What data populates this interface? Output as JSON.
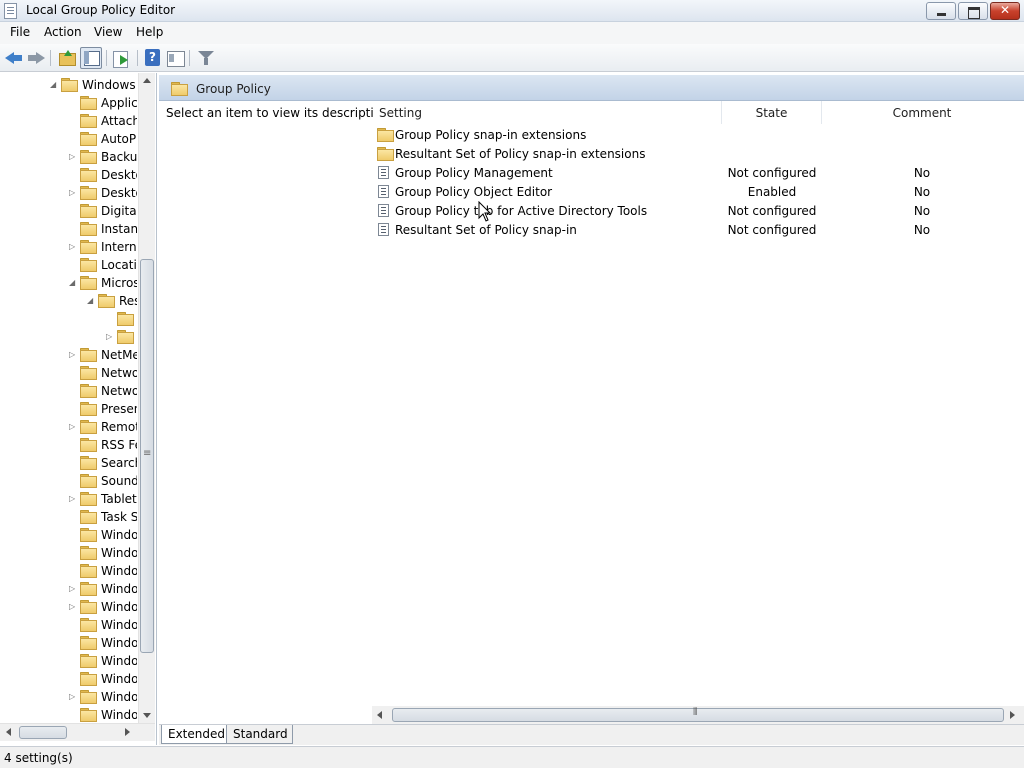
{
  "window": {
    "title": "Local Group Policy Editor"
  },
  "menu": {
    "items": [
      "File",
      "Action",
      "View",
      "Help"
    ]
  },
  "toolbar": {
    "icons": [
      "back-arrow-icon",
      "forward-arrow-icon",
      "up-folder-icon",
      "show-hide-console-tree-icon",
      "export-list-icon",
      "help-icon",
      "properties-icon",
      "filter-icon"
    ]
  },
  "tree": {
    "items": [
      {
        "label": "Windows C",
        "expander": "◢",
        "level": 0
      },
      {
        "label": "Applic",
        "expander": "",
        "level": 1
      },
      {
        "label": "Attach",
        "expander": "",
        "level": 1
      },
      {
        "label": "AutoPl",
        "expander": "",
        "level": 1
      },
      {
        "label": "Backup",
        "expander": "▷",
        "level": 1
      },
      {
        "label": "Deskto",
        "expander": "",
        "level": 1
      },
      {
        "label": "Deskto",
        "expander": "▷",
        "level": 1
      },
      {
        "label": "Digital",
        "expander": "",
        "level": 1
      },
      {
        "label": "Instant",
        "expander": "",
        "level": 1
      },
      {
        "label": "Interne",
        "expander": "▷",
        "level": 1
      },
      {
        "label": "Locatio",
        "expander": "",
        "level": 1
      },
      {
        "label": "Micros",
        "expander": "◢",
        "level": 1
      },
      {
        "label": "Res",
        "expander": "◢",
        "level": 2
      },
      {
        "label": "",
        "expander": "",
        "level": 3
      },
      {
        "label": "",
        "expander": "▷",
        "level": 3
      },
      {
        "label": "NetMe",
        "expander": "▷",
        "level": 1
      },
      {
        "label": "Netwo",
        "expander": "",
        "level": 1
      },
      {
        "label": "Netwo",
        "expander": "",
        "level": 1
      },
      {
        "label": "Presen",
        "expander": "",
        "level": 1
      },
      {
        "label": "Remot",
        "expander": "▷",
        "level": 1
      },
      {
        "label": "RSS Fe",
        "expander": "",
        "level": 1
      },
      {
        "label": "Search",
        "expander": "",
        "level": 1
      },
      {
        "label": "Sound",
        "expander": "",
        "level": 1
      },
      {
        "label": "Tablet",
        "expander": "▷",
        "level": 1
      },
      {
        "label": "Task Sc",
        "expander": "",
        "level": 1
      },
      {
        "label": "Windo",
        "expander": "",
        "level": 1
      },
      {
        "label": "Windo",
        "expander": "",
        "level": 1
      },
      {
        "label": "Windo",
        "expander": "",
        "level": 1
      },
      {
        "label": "Windo",
        "expander": "▷",
        "level": 1
      },
      {
        "label": "Windo",
        "expander": "▷",
        "level": 1
      },
      {
        "label": "Windo",
        "expander": "",
        "level": 1
      },
      {
        "label": "Windo",
        "expander": "",
        "level": 1
      },
      {
        "label": "Windo",
        "expander": "",
        "level": 1
      },
      {
        "label": "Windo",
        "expander": "",
        "level": 1
      },
      {
        "label": "Windo",
        "expander": "▷",
        "level": 1
      },
      {
        "label": "Windo",
        "expander": "",
        "level": 1
      }
    ]
  },
  "main": {
    "header_title": "Group Policy",
    "description": "Select an item to view its description.",
    "columns": {
      "setting": "Setting",
      "state": "State",
      "comment": "Comment"
    },
    "rows": [
      {
        "type": "folder",
        "setting": "Group Policy snap-in extensions",
        "state": "",
        "comment": ""
      },
      {
        "type": "folder",
        "setting": "Resultant Set of Policy snap-in extensions",
        "state": "",
        "comment": ""
      },
      {
        "type": "policy",
        "setting": "Group Policy Management",
        "state": "Not configured",
        "comment": "No"
      },
      {
        "type": "policy",
        "setting": "Group Policy Object Editor",
        "state": "Enabled",
        "comment": "No"
      },
      {
        "type": "policy",
        "setting": "Group Policy tab for Active Directory Tools",
        "state": "Not configured",
        "comment": "No"
      },
      {
        "type": "policy",
        "setting": "Resultant Set of Policy snap-in",
        "state": "Not configured",
        "comment": "No"
      }
    ]
  },
  "tabs": {
    "extended": "Extended",
    "standard": "Standard"
  },
  "status": {
    "text": "4 setting(s)"
  },
  "colors": {
    "header_band": "#c3d3e7",
    "folder": "#efcb6b",
    "close_button": "#c8412c"
  }
}
